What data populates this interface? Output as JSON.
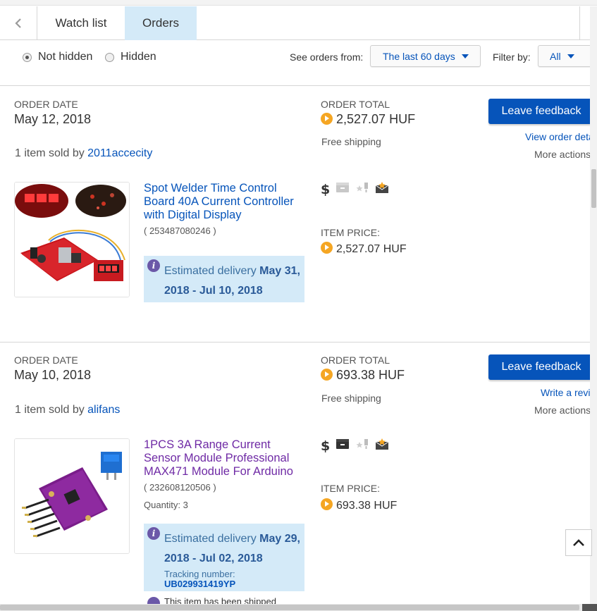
{
  "tabs": {
    "watch_list": "Watch list",
    "orders": "Orders"
  },
  "filters": {
    "not_hidden": "Not hidden",
    "hidden": "Hidden",
    "see_orders_from": "See orders from:",
    "range": "The last 60 days",
    "filter_by": "Filter by:",
    "filter_value": "All"
  },
  "orders": [
    {
      "order_date_label": "ORDER DATE",
      "order_date": "May 12, 2018",
      "sold_prefix": "1 item sold by ",
      "seller": "2011accecity",
      "order_total_label": "ORDER TOTAL",
      "order_total": "2,527.07 HUF",
      "shipping": "Free shipping",
      "feedback_button": "Leave feedback",
      "link": "View order deta",
      "more_actions": "More actions",
      "item": {
        "title": "Spot Welder Time Control Board 40A Current Controller with Digital Display",
        "item_number": "( 253487080246 )",
        "item_price_label": "ITEM PRICE:",
        "item_price": "2,527.07 HUF",
        "estimated_prefix": "Estimated delivery ",
        "estimated_dates": "May 31, 2018 - Jul 10, 2018",
        "icons": [
          "dollar-icon",
          "package-icon",
          "star-feedback-icon",
          "envelope-icon"
        ]
      }
    },
    {
      "order_date_label": "ORDER DATE",
      "order_date": "May 10, 2018",
      "sold_prefix": "1 item sold by ",
      "seller": "alifans",
      "order_total_label": "ORDER TOTAL",
      "order_total": "693.38 HUF",
      "shipping": "Free shipping",
      "feedback_button": "Leave feedback",
      "link": "Write a revi",
      "more_actions": "More actions",
      "item": {
        "title": "1PCS 3A Range Current Sensor Module Professional MAX471 Module For Arduino",
        "item_number": "( 232608120506 )",
        "quantity": "Quantity: 3",
        "item_price_label": "ITEM PRICE:",
        "item_price": "693.38 HUF",
        "estimated_prefix": "Estimated delivery ",
        "estimated_dates": "May 29, 2018 - Jul 02, 2018",
        "tracking_label": "Tracking number:",
        "tracking_number": "UB029931419YP",
        "shipped_note": "This item has been shipped",
        "icons": [
          "dollar-icon",
          "package-icon",
          "star-feedback-icon",
          "envelope-icon"
        ]
      }
    }
  ],
  "colors": {
    "link": "#0654ba",
    "tab_active_bg": "#d4eaf8",
    "button": "#0654ba",
    "coin": "#f5a623",
    "visited": "#6f2aa5"
  }
}
